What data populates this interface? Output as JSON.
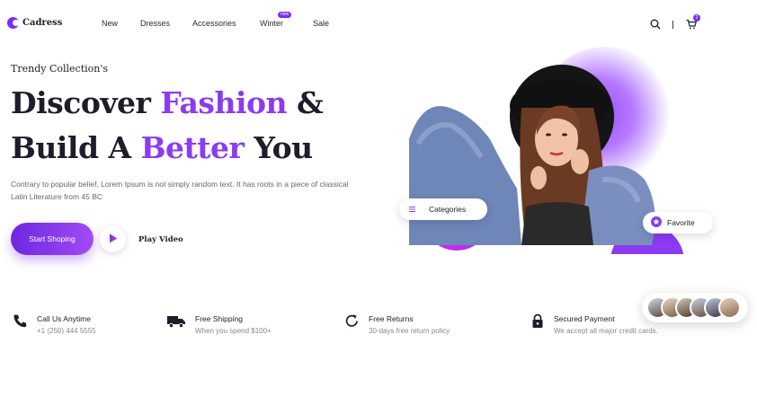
{
  "brand": {
    "name": "Cadress",
    "color": "#7a2ff0"
  },
  "nav": {
    "items": [
      {
        "label": "New"
      },
      {
        "label": "Dresses"
      },
      {
        "label": "Accessories"
      },
      {
        "label": "Winter",
        "badge": "new"
      },
      {
        "label": "Sale"
      }
    ]
  },
  "header": {
    "cart_count": "2",
    "icons": [
      "search-icon",
      "cart-icon"
    ]
  },
  "hero": {
    "eyebrow": "Trendy Collection's",
    "line1_a": "Discover ",
    "line1_b": "Fashion",
    "line1_c": " &",
    "line2_a": "Build A ",
    "line2_b": "Better",
    "line2_c": " You",
    "description": "Contrary to popular belief, Lorem Ipsum is not simply random text. It has roots in a piece of classical Latin Literature from 45 BC",
    "cta_label": "Start Shoping",
    "play_label": "Play Video",
    "accent_color": "#8b3bf2"
  },
  "chips": {
    "categories": "Categories",
    "favorite": "Favorite"
  },
  "features": [
    {
      "title": "Call Us Anytime",
      "subtitle": "+1 (250) 444 5555",
      "icon": "phone-icon"
    },
    {
      "title": "Free Shipping",
      "subtitle": "When you spend $100+",
      "icon": "truck-icon"
    },
    {
      "title": "Free Returns",
      "subtitle": "30-days free return policy",
      "icon": "return-icon"
    },
    {
      "title": "Secured Payment",
      "subtitle": "We accept all major credit cards.",
      "icon": "lock-icon"
    }
  ]
}
